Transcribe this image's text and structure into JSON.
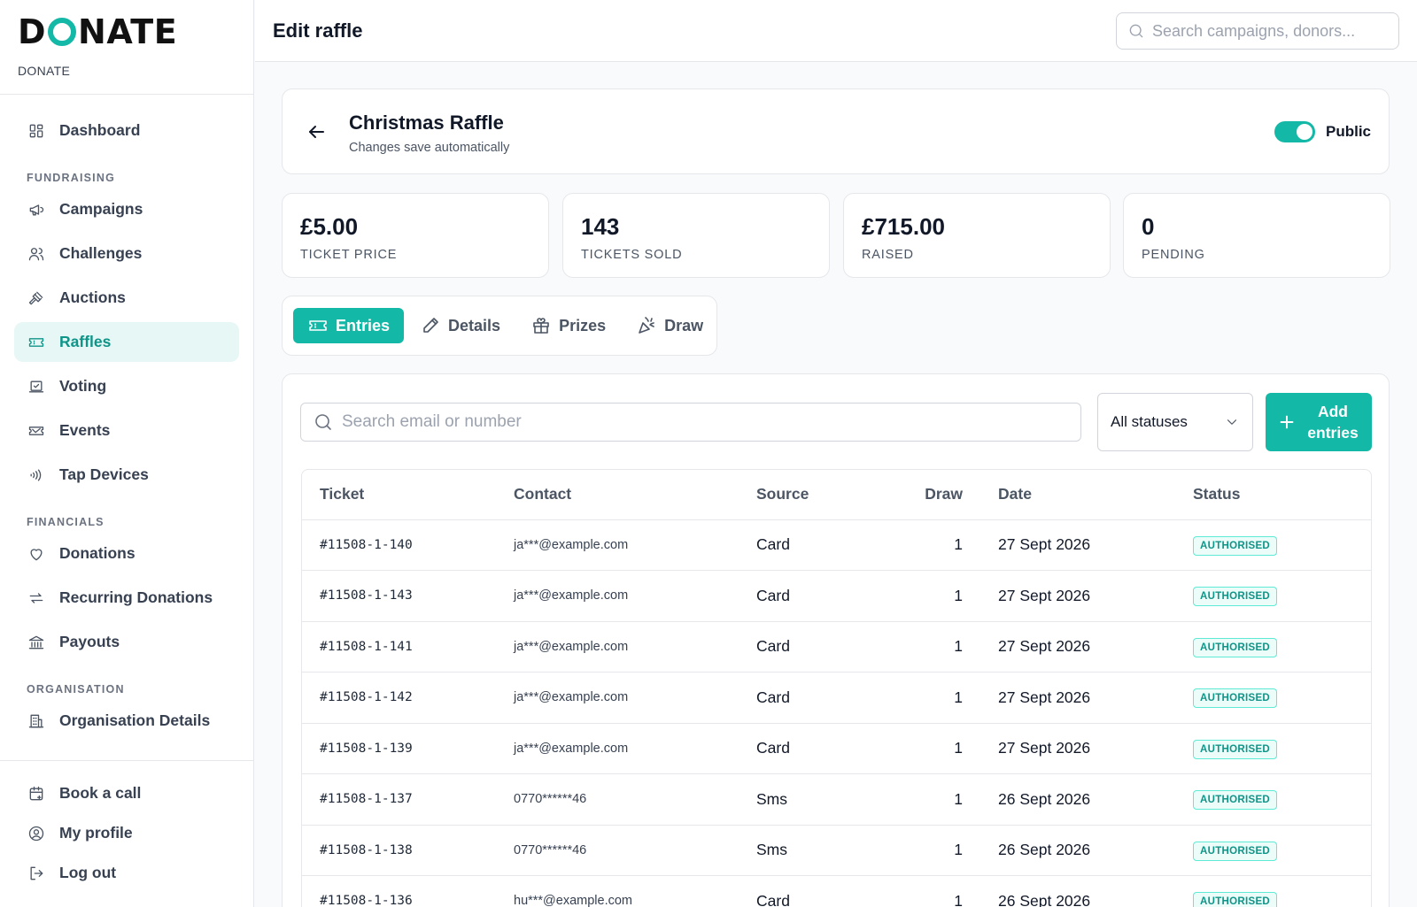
{
  "brand": {
    "logo_left": "D",
    "logo_right": "NATE",
    "subtitle": "DONATE"
  },
  "colors": {
    "accent": "#14b8a6",
    "accent_dark": "#0f9488",
    "active_bg": "#e6f7f5"
  },
  "sidebar": {
    "dashboard": {
      "label": "Dashboard",
      "icon": "grid-icon"
    },
    "sections": [
      {
        "title": "FUNDRAISING",
        "items": [
          {
            "label": "Campaigns",
            "icon": "megaphone-icon"
          },
          {
            "label": "Challenges",
            "icon": "users-icon"
          },
          {
            "label": "Auctions",
            "icon": "gavel-icon"
          },
          {
            "label": "Raffles",
            "icon": "ticket-icon",
            "active": true
          },
          {
            "label": "Voting",
            "icon": "ballot-icon"
          },
          {
            "label": "Events",
            "icon": "ticket-icon"
          },
          {
            "label": "Tap Devices",
            "icon": "contactless-icon"
          }
        ]
      },
      {
        "title": "FINANCIALS",
        "items": [
          {
            "label": "Donations",
            "icon": "heart-icon"
          },
          {
            "label": "Recurring Donations",
            "icon": "repeat-icon"
          },
          {
            "label": "Payouts",
            "icon": "bank-icon"
          }
        ]
      },
      {
        "title": "ORGANISATION",
        "items": [
          {
            "label": "Organisation Details",
            "icon": "building-icon"
          }
        ]
      }
    ],
    "bottom": [
      {
        "label": "Book a call",
        "icon": "calendar-icon"
      },
      {
        "label": "My profile",
        "icon": "user-circle-icon"
      },
      {
        "label": "Log out",
        "icon": "logout-icon"
      }
    ]
  },
  "header": {
    "title": "Edit raffle",
    "search_placeholder": "Search campaigns, donors..."
  },
  "raffle": {
    "title": "Christmas Raffle",
    "subtitle": "Changes save automatically",
    "public_label": "Public",
    "public_on": true
  },
  "stats": [
    {
      "value": "£5.00",
      "label": "TICKET PRICE"
    },
    {
      "value": "143",
      "label": "TICKETS SOLD"
    },
    {
      "value": "£715.00",
      "label": "RAISED"
    },
    {
      "value": "0",
      "label": "PENDING"
    }
  ],
  "tabs": [
    {
      "label": "Entries",
      "icon": "ticket-icon",
      "active": true
    },
    {
      "label": "Details",
      "icon": "pencil-icon"
    },
    {
      "label": "Prizes",
      "icon": "gift-icon"
    },
    {
      "label": "Draw",
      "icon": "party-popper-icon"
    }
  ],
  "entries": {
    "search_placeholder": "Search email or number",
    "status_filter": "All statuses",
    "add_label": "Add entries",
    "columns": [
      "Ticket",
      "Contact",
      "Source",
      "Draw",
      "Date",
      "Status"
    ],
    "rows": [
      {
        "ticket": "#11508-1-140",
        "contact": "ja***@example.com",
        "source": "Card",
        "draw": "1",
        "date": "27 Sept 2026",
        "status": "AUTHORISED"
      },
      {
        "ticket": "#11508-1-143",
        "contact": "ja***@example.com",
        "source": "Card",
        "draw": "1",
        "date": "27 Sept 2026",
        "status": "AUTHORISED"
      },
      {
        "ticket": "#11508-1-141",
        "contact": "ja***@example.com",
        "source": "Card",
        "draw": "1",
        "date": "27 Sept 2026",
        "status": "AUTHORISED"
      },
      {
        "ticket": "#11508-1-142",
        "contact": "ja***@example.com",
        "source": "Card",
        "draw": "1",
        "date": "27 Sept 2026",
        "status": "AUTHORISED"
      },
      {
        "ticket": "#11508-1-139",
        "contact": "ja***@example.com",
        "source": "Card",
        "draw": "1",
        "date": "27 Sept 2026",
        "status": "AUTHORISED"
      },
      {
        "ticket": "#11508-1-137",
        "contact": "0770******46",
        "source": "Sms",
        "draw": "1",
        "date": "26 Sept 2026",
        "status": "AUTHORISED"
      },
      {
        "ticket": "#11508-1-138",
        "contact": "0770******46",
        "source": "Sms",
        "draw": "1",
        "date": "26 Sept 2026",
        "status": "AUTHORISED"
      },
      {
        "ticket": "#11508-1-136",
        "contact": "hu***@example.com",
        "source": "Card",
        "draw": "1",
        "date": "26 Sept 2026",
        "status": "AUTHORISED"
      }
    ]
  }
}
